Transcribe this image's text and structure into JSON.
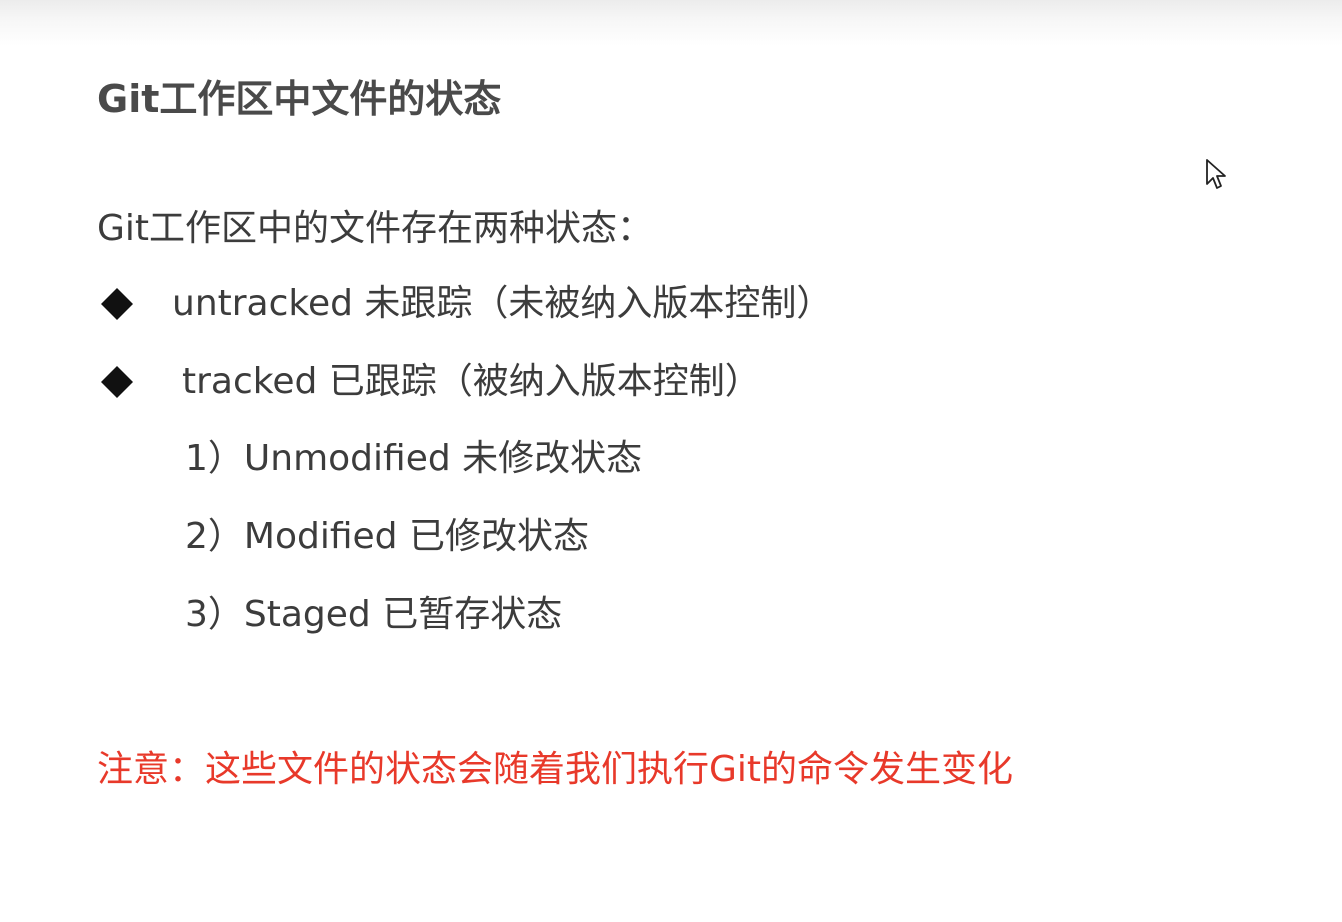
{
  "slide": {
    "title": "Git工作区中文件的状态",
    "intro": "Git工作区中的文件存在两种状态：",
    "bullets": [
      {
        "text": "untracked 未跟踪（未被纳入版本控制）"
      },
      {
        "text": "tracked 已跟踪（被纳入版本控制）"
      }
    ],
    "sub_items": [
      "1）Unmodified 未修改状态",
      "2）Modified 已修改状态",
      "3）Staged 已暂存状态"
    ],
    "note": "注意：这些文件的状态会随着我们执行Git的命令发生变化"
  },
  "icons": {
    "bullet": "diamond-bullet-icon",
    "cursor": "mouse-pointer-icon"
  },
  "colors": {
    "text": "#3c3c3c",
    "title": "#4a4a4a",
    "note": "#e8392a"
  }
}
